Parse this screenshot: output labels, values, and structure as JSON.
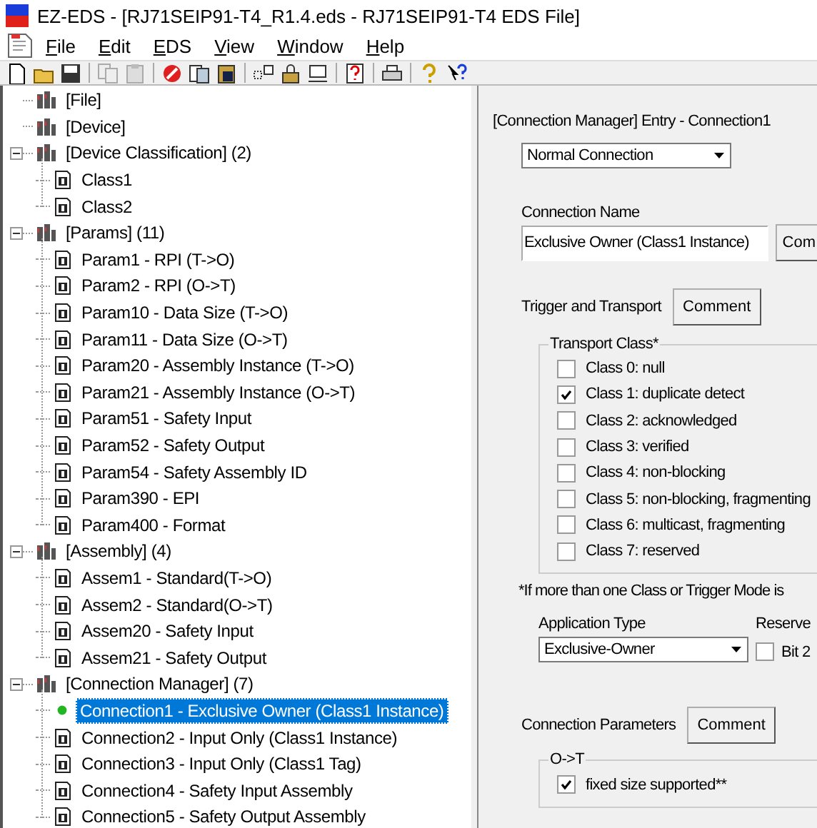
{
  "window": {
    "title": "EZ-EDS - [RJ71SEIP91-T4_R1.4.eds - RJ71SEIP91-T4 EDS File]"
  },
  "menu": [
    "File",
    "Edit",
    "EDS",
    "View",
    "Window",
    "Help"
  ],
  "tree": [
    {
      "label": "[File]",
      "kind": "group",
      "selected": false
    },
    {
      "label": "[Device]",
      "kind": "group",
      "selected": false
    },
    {
      "label": "[Device Classification] (2)",
      "kind": "group",
      "selected": false,
      "expanded": true,
      "children": [
        {
          "label": "Class1",
          "kind": "doc",
          "selected": false
        },
        {
          "label": "Class2",
          "kind": "doc",
          "selected": false
        }
      ]
    },
    {
      "label": "[Params] (11)",
      "kind": "group",
      "selected": false,
      "expanded": true,
      "children": [
        {
          "label": "Param1 - RPI (T->O)",
          "kind": "doc",
          "selected": false
        },
        {
          "label": "Param2 - RPI (O->T)",
          "kind": "doc",
          "selected": false
        },
        {
          "label": "Param10 - Data Size (T->O)",
          "kind": "doc",
          "selected": false
        },
        {
          "label": "Param11 - Data Size (O->T)",
          "kind": "doc",
          "selected": false
        },
        {
          "label": "Param20 - Assembly Instance (T->O)",
          "kind": "doc",
          "selected": false
        },
        {
          "label": "Param21 - Assembly Instance (O->T)",
          "kind": "doc",
          "selected": false
        },
        {
          "label": "Param51 - Safety Input",
          "kind": "doc",
          "selected": false
        },
        {
          "label": "Param52 - Safety Output",
          "kind": "doc",
          "selected": false
        },
        {
          "label": "Param54 - Safety Assembly ID",
          "kind": "doc",
          "selected": false
        },
        {
          "label": "Param390 - EPI",
          "kind": "doc",
          "selected": false
        },
        {
          "label": "Param400 - Format",
          "kind": "doc",
          "selected": false
        }
      ]
    },
    {
      "label": "[Assembly] (4)",
      "kind": "group",
      "selected": false,
      "expanded": true,
      "children": [
        {
          "label": "Assem1 - Standard(T->O)",
          "kind": "doc",
          "selected": false
        },
        {
          "label": "Assem2 - Standard(O->T)",
          "kind": "doc",
          "selected": false
        },
        {
          "label": "Assem20 - Safety Input",
          "kind": "doc",
          "selected": false
        },
        {
          "label": "Assem21 - Safety Output",
          "kind": "doc",
          "selected": false
        }
      ]
    },
    {
      "label": "[Connection Manager] (7)",
      "kind": "group",
      "selected": false,
      "expanded": true,
      "children": [
        {
          "label": "Connection1 - Exclusive Owner (Class1 Instance)",
          "kind": "dot",
          "selected": true
        },
        {
          "label": "Connection2 - Input Only (Class1 Instance)",
          "kind": "doc",
          "selected": false
        },
        {
          "label": "Connection3 - Input Only (Class1 Tag)",
          "kind": "doc",
          "selected": false
        },
        {
          "label": "Connection4 - Safety Input Assembly",
          "kind": "doc",
          "selected": false
        },
        {
          "label": "Connection5 - Safety Output Assembly",
          "kind": "doc",
          "selected": false
        }
      ]
    }
  ],
  "entry": {
    "heading": "[Connection Manager] Entry - Connection1",
    "connection_type": {
      "value": "Normal Connection"
    },
    "connection_name": {
      "label": "Connection Name",
      "value": "Exclusive Owner (Class1 Instance)",
      "button": "Com"
    },
    "trigger": {
      "label": "Trigger and Transport",
      "button": "Comment"
    },
    "transport_class": {
      "legend": "Transport Class*",
      "options": [
        {
          "label": "Class 0: null",
          "checked": false
        },
        {
          "label": "Class 1: duplicate detect",
          "checked": true
        },
        {
          "label": "Class 2: acknowledged",
          "checked": false
        },
        {
          "label": "Class 3: verified",
          "checked": false
        },
        {
          "label": "Class 4: non-blocking",
          "checked": false
        },
        {
          "label": "Class 5: non-blocking, fragmenting",
          "checked": false
        },
        {
          "label": "Class 6: multicast, fragmenting",
          "checked": false
        },
        {
          "label": "Class 7: reserved",
          "checked": false
        }
      ]
    },
    "note": "*If more than one Class or Trigger Mode is",
    "application_type": {
      "label": "Application Type",
      "value": "Exclusive-Owner"
    },
    "reserved": {
      "label": "Reserve",
      "option": {
        "label": "Bit 2",
        "checked": false
      }
    },
    "connection_parameters": {
      "label": "Connection Parameters",
      "button": "Comment"
    },
    "o_to_t": {
      "legend": "O->T",
      "options": [
        {
          "label": "fixed size supported**",
          "checked": true
        }
      ]
    }
  }
}
